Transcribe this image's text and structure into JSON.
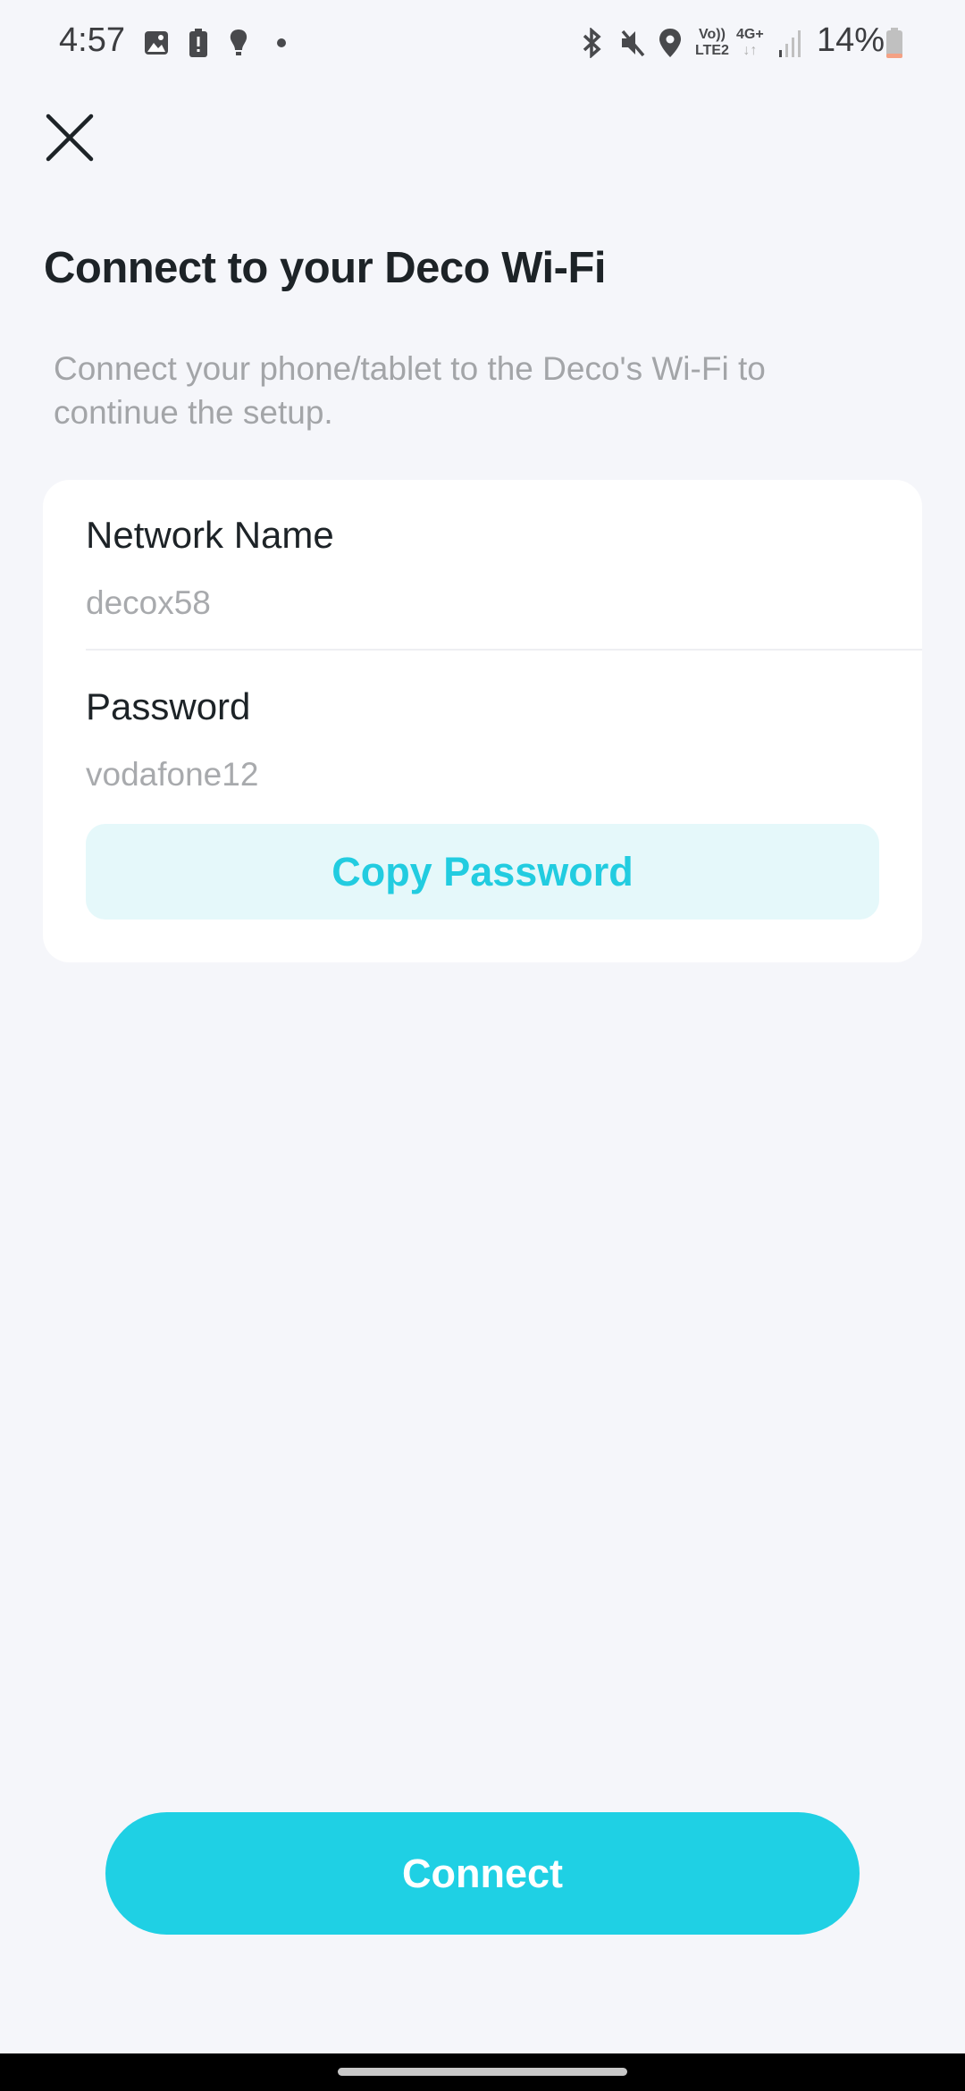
{
  "status_bar": {
    "time": "4:57",
    "battery_percent": "14%",
    "battery_level": 0.14,
    "network_top": "Vo))",
    "network_bottom": "LTE2",
    "data_type": "4G+",
    "icons": [
      "gallery-icon",
      "battery-alert-icon",
      "bulb-icon",
      "dot-icon",
      "bluetooth-icon",
      "mute-icon",
      "location-icon",
      "volte-icon",
      "data-icon",
      "signal-icon",
      "battery-icon"
    ]
  },
  "header": {
    "close_icon": "close-icon"
  },
  "page": {
    "title": "Connect to your Deco Wi-Fi",
    "subtitle": "Connect your phone/tablet to the Deco's Wi-Fi to continue the setup."
  },
  "card": {
    "network_name_label": "Network Name",
    "network_name_value": "decox58",
    "password_label": "Password",
    "password_value": "vodafone12",
    "copy_button": "Copy Password"
  },
  "footer": {
    "connect_button": "Connect"
  },
  "colors": {
    "accent": "#1fd0e4",
    "accent_light": "#e5f8fa",
    "background": "#f5f6fa"
  }
}
